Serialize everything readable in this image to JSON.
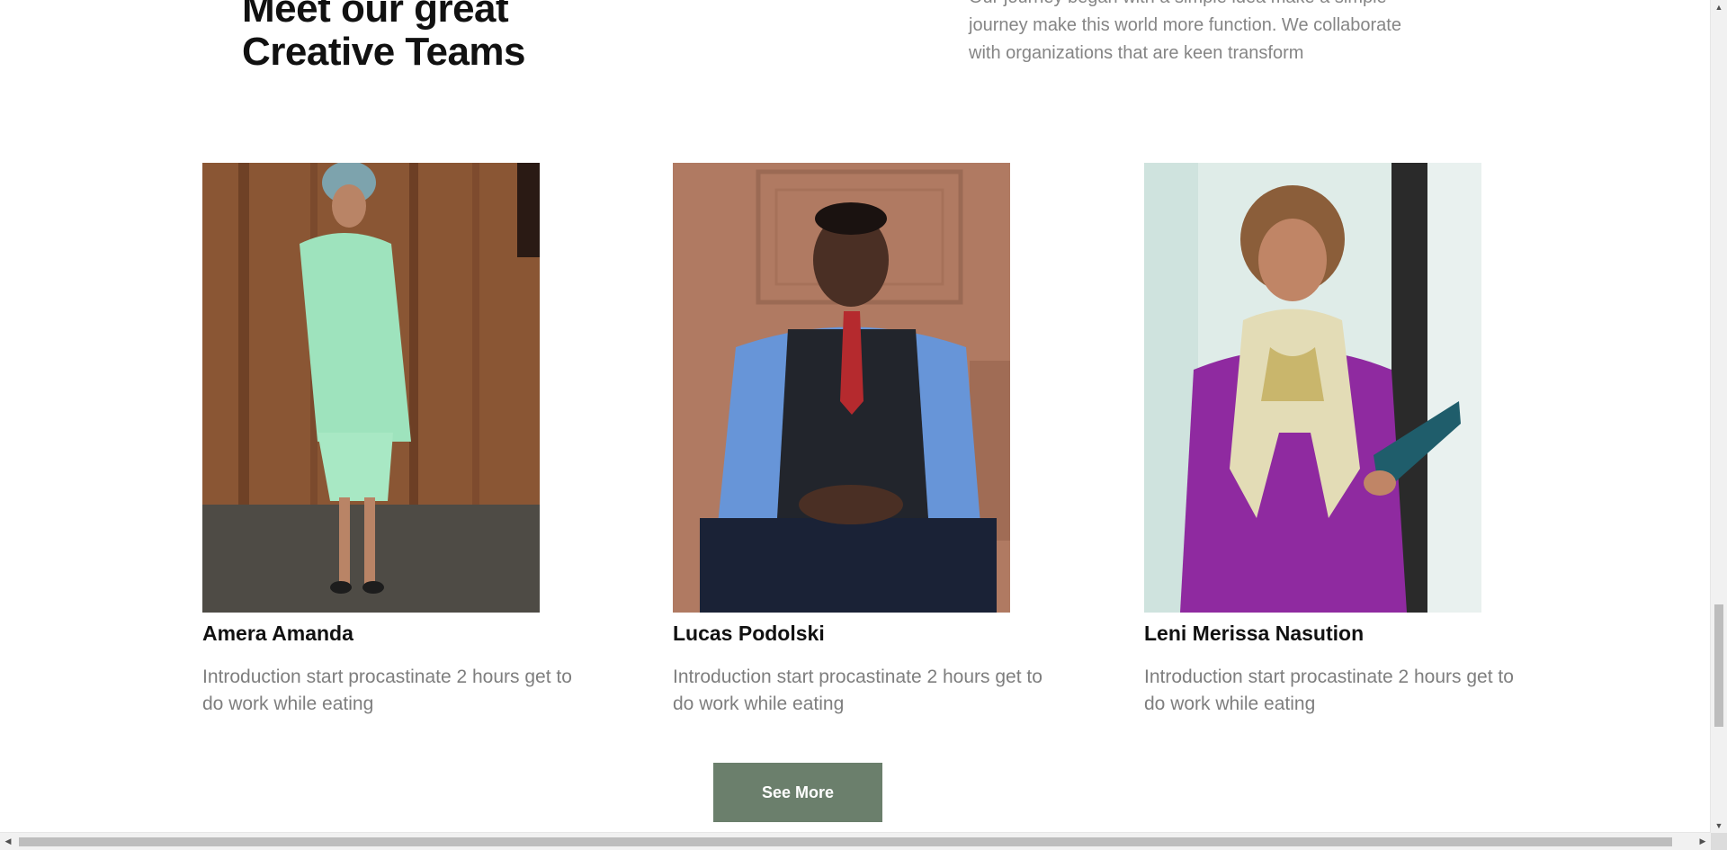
{
  "section": {
    "heading_line1": "Meet our great",
    "heading_line2": "Creative Teams",
    "intro_line1": "Our journey began with a simple idea make a simple",
    "intro_line2": "journey make this world more function. We collaborate",
    "intro_line3": "with organizations that are keen transform"
  },
  "team": [
    {
      "name": "Amera Amanda",
      "description": "Introduction start procastinate 2 hours get to do work while eating"
    },
    {
      "name": "Lucas Podolski",
      "description": "Introduction start procastinate 2 hours get to do work while eating"
    },
    {
      "name": "Leni Merissa Nasution",
      "description": "Introduction start procastinate 2 hours get to do work while eating"
    }
  ],
  "cta": {
    "label": "See More"
  },
  "colors": {
    "button": "#6b7f6c",
    "heading": "#111111",
    "muted_text": "#7e7e7e"
  },
  "icons": {
    "scroll_up": "triangle-up-icon",
    "scroll_down": "triangle-down-icon",
    "scroll_left": "triangle-left-icon",
    "scroll_right": "triangle-right-icon"
  }
}
